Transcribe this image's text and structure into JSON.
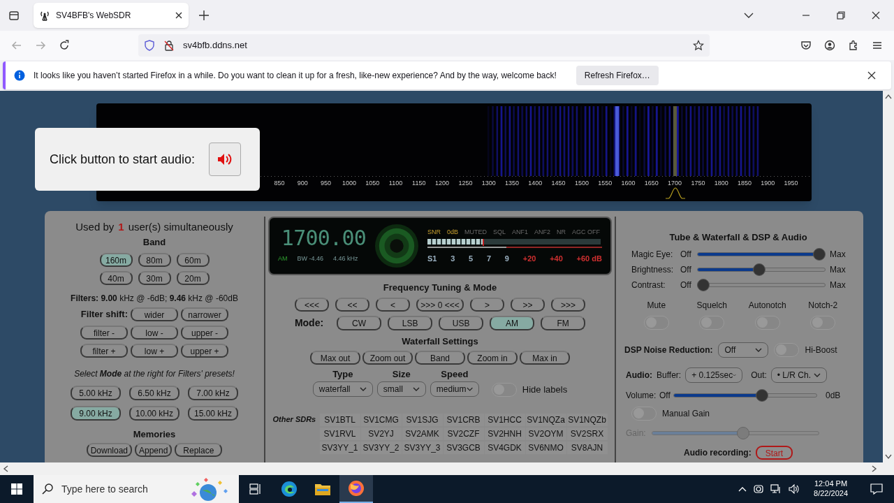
{
  "browser": {
    "tab_title": "SV4BFB's WebSDR",
    "url": "sv4bfb.ddns.net",
    "notification": {
      "text": "It looks like you haven’t started Firefox in a while. Do you want to clean it up for a fresh, like-new experience? And by the way, welcome back!",
      "button": "Refresh Firefox…"
    }
  },
  "waterfall": {
    "scale_labels": [
      "850",
      "900",
      "950",
      "1000",
      "1050",
      "1100",
      "1150",
      "1200",
      "1250",
      "1300",
      "1350",
      "1400",
      "1450",
      "1500",
      "1550",
      "1600",
      "1650",
      "1700",
      "1750",
      "1800",
      "1850",
      "1900",
      "1950"
    ]
  },
  "audio_prompt": {
    "text": "Click button to start audio:"
  },
  "left_panel": {
    "users_prefix": "Used by",
    "users_count": "1",
    "users_suffix": "user(s) simultaneously",
    "band_title": "Band",
    "bands": [
      {
        "label": "160m",
        "selected": true
      },
      {
        "label": "80m",
        "selected": false
      },
      {
        "label": "60m",
        "selected": false
      },
      {
        "label": "40m",
        "selected": false
      },
      {
        "label": "30m",
        "selected": false
      },
      {
        "label": "20m",
        "selected": false
      }
    ],
    "filters": "**Filters:** **9.00** kHz @ -6dB; **9.46** kHz @ -60dB",
    "filter_shift_label": "Filter shift:",
    "filter_buttons": [
      "wider",
      "narrower",
      "filter -",
      "low -",
      "upper -",
      "filter +",
      "low +",
      "upper +"
    ],
    "presets_hint": "Select **Mode** at the right for Filters' presets!",
    "presets": [
      {
        "label": "5.00 kHz",
        "selected": false
      },
      {
        "label": "6.50 kHz",
        "selected": false
      },
      {
        "label": "7.00 kHz",
        "selected": false
      },
      {
        "label": "9.00 kHz",
        "selected": true
      },
      {
        "label": "10.00 kHz",
        "selected": false
      },
      {
        "label": "15.00 kHz",
        "selected": false
      }
    ],
    "memories_title": "Memories",
    "memory_buttons": [
      "Download",
      "Append",
      "Replace"
    ]
  },
  "display": {
    "frequency": "1700.00",
    "mode": "AM",
    "bw": "BW -4.46",
    "bw_khz": "4.46 kHz",
    "indicators": [
      {
        "label": "SNR",
        "on": true
      },
      {
        "label": "0dB",
        "on": true
      },
      {
        "label": "MUTED",
        "on": false
      },
      {
        "label": "SQL",
        "on": false
      },
      {
        "label": "ANF1",
        "on": false
      },
      {
        "label": "ANF2",
        "on": false
      },
      {
        "label": "NR",
        "on": false
      },
      {
        "label": "AGC OFF",
        "on": false
      }
    ],
    "s_meter": {
      "level": 0.32
    },
    "scale": [
      "S1",
      "3",
      "5",
      "7",
      "9",
      "+20",
      "+40",
      "+60 dB"
    ]
  },
  "tuning": {
    "title": "Frequency Tuning & Mode",
    "step_buttons": [
      "<<<",
      "<<",
      "<",
      ">>> 0 <<<",
      ">",
      ">>",
      ">>>"
    ],
    "mode_label": "Mode:",
    "modes": [
      {
        "label": "CW",
        "selected": false
      },
      {
        "label": "LSB",
        "selected": false
      },
      {
        "label": "USB",
        "selected": false
      },
      {
        "label": "AM",
        "selected": true
      },
      {
        "label": "FM",
        "selected": false
      }
    ]
  },
  "waterfall_settings": {
    "title": "Waterfall Settings",
    "buttons": [
      "Max out",
      "Zoom out",
      "Band",
      "Zoom in",
      "Max in"
    ],
    "selects": [
      {
        "label": "Type",
        "value": "waterfall"
      },
      {
        "label": "Size",
        "value": "small"
      },
      {
        "label": "Speed",
        "value": "medium"
      }
    ],
    "hide_labels": {
      "label": "Hide labels",
      "on": false
    }
  },
  "other_sdrs": {
    "label": "Other SDRs",
    "items": [
      "SV1BTL",
      "SV1CMG",
      "SV1SJG",
      "SV1CRB",
      "SV1HCC",
      "SV1NQZa",
      "SV1NQZb",
      "SV1RVL",
      "SV2YJ",
      "SV2AMK",
      "SV2CZF",
      "SV2HNH",
      "SV2OYM",
      "SV2SRX",
      "SV3YY_1",
      "SV3YY_2",
      "SV3YY_3",
      "SV3GCB",
      "SV4GDK",
      "SV6NMO",
      "SV8AJN"
    ]
  },
  "right_panel": {
    "title": "Tube & Waterfall & DSP & Audio",
    "sliders": [
      {
        "label": "Magic Eye:",
        "min": "Off",
        "max": "Max",
        "level": 1.0
      },
      {
        "label": "Brightness:",
        "min": "Off",
        "max": "Max",
        "level": 0.48
      },
      {
        "label": "Contrast:",
        "min": "Off",
        "max": "Max",
        "level": 0.0
      }
    ],
    "toggles": [
      {
        "label": "Mute",
        "on": false
      },
      {
        "label": "Squelch",
        "on": false
      },
      {
        "label": "Autonotch",
        "on": false
      },
      {
        "label": "Notch-2",
        "on": false
      }
    ],
    "dsp_label": "DSP Noise Reduction:",
    "dsp_value": "Off",
    "hi_boost": {
      "label": "Hi-Boost",
      "on": false
    },
    "audio_label": "Audio:",
    "buffer_label": "Buffer:",
    "buffer_value": "+ 0.125sec",
    "out_label": "Out:",
    "out_value": "• L/R Ch.",
    "volume": {
      "label": "Volume:",
      "min": "Off",
      "max": "0dB",
      "level": 0.63
    },
    "manual_gain": {
      "label": "Manual Gain",
      "on": false
    },
    "gain": {
      "label": "Gain:",
      "level": 0.55,
      "disabled": true
    },
    "record_label": "Audio recording:",
    "record_button": "Start"
  },
  "taskbar": {
    "search_placeholder": "Type here to search",
    "time": "12:04 PM",
    "date": "8/22/2024"
  }
}
